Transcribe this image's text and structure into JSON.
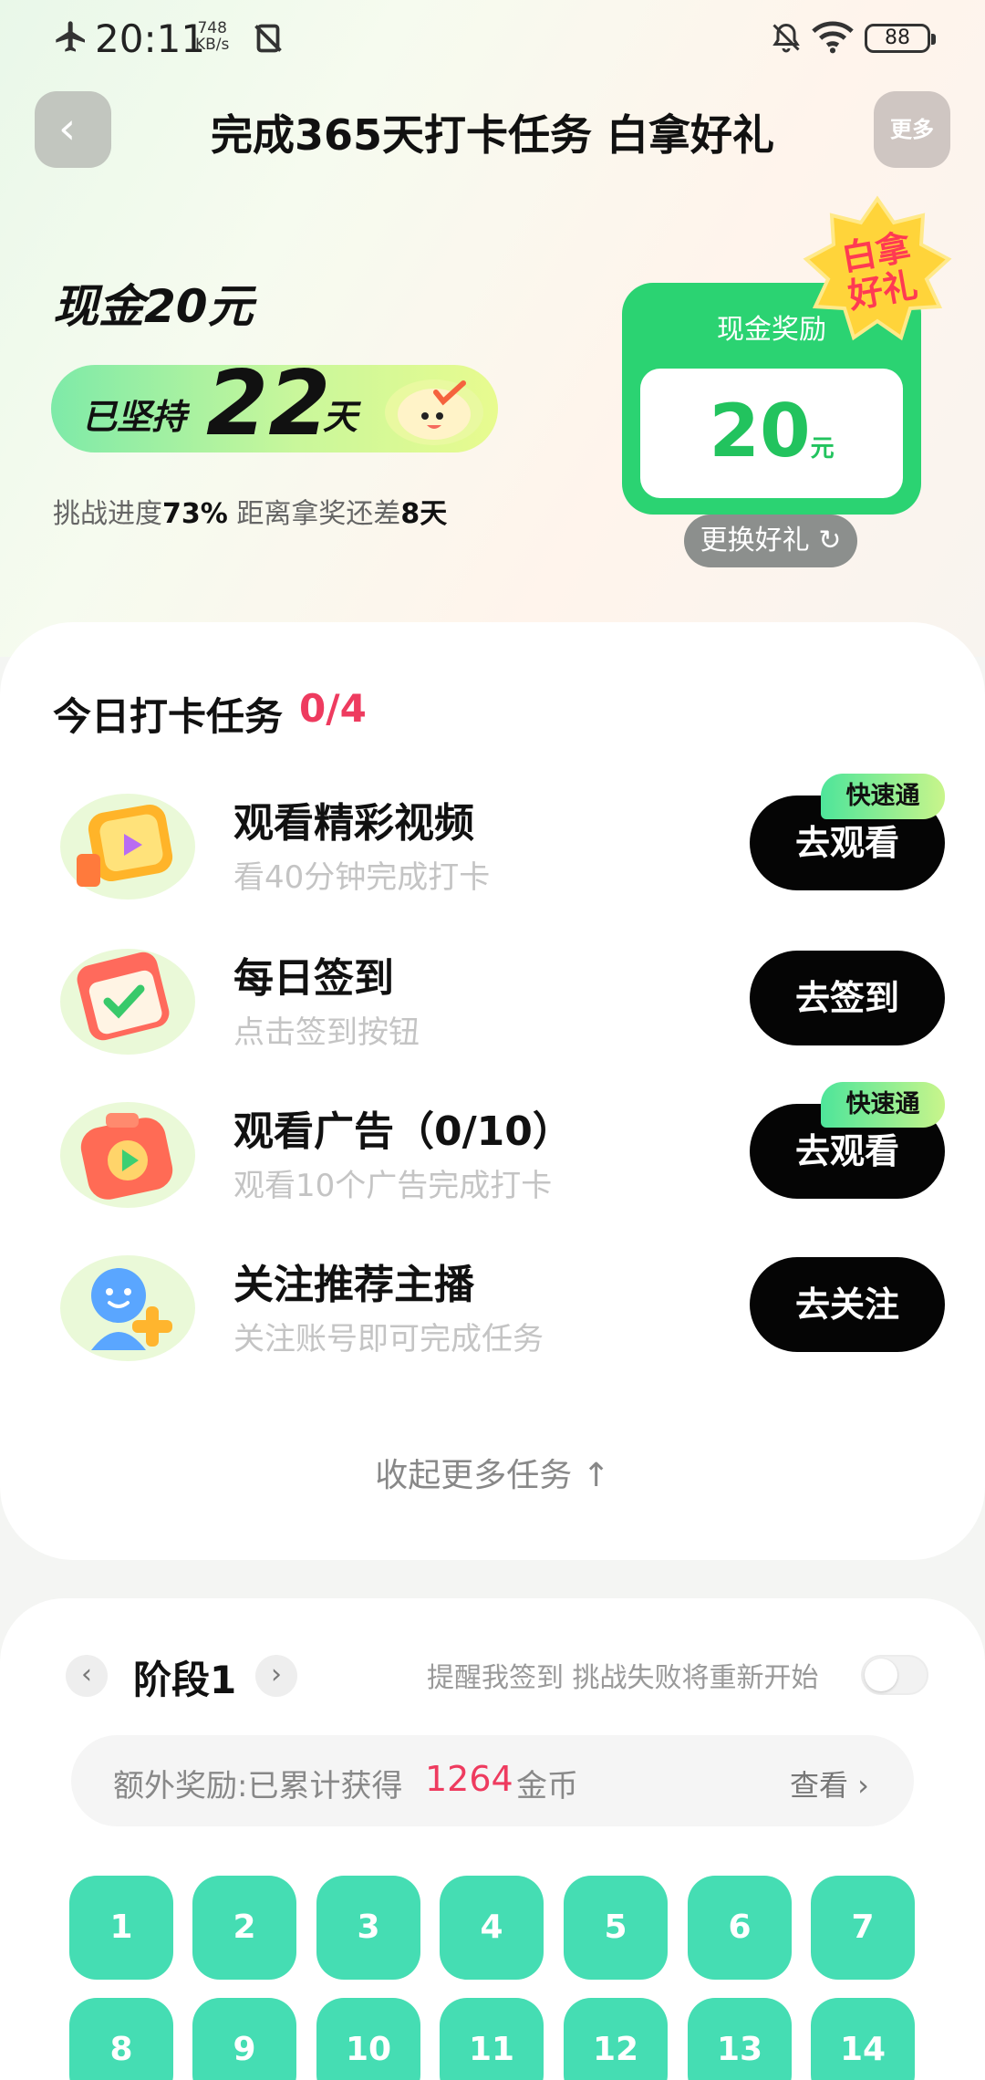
{
  "status_bar": {
    "time": "20:11",
    "net_speed": "748",
    "net_unit": "KB/s",
    "battery": "88"
  },
  "header": {
    "title": "完成365天打卡任务 白拿好礼",
    "more_label": "更多"
  },
  "hero": {
    "cash_title": "现金20元",
    "streak_prefix": "已坚持",
    "streak_days": "22",
    "streak_unit": "天",
    "progress_label": "挑战进度",
    "progress_value": "73%",
    "remaining_label": "距离拿奖还差",
    "remaining_value": "8天",
    "reward": {
      "label": "现金奖励",
      "amount": "20",
      "unit": "元",
      "badge_line1": "白拿",
      "badge_line2": "好礼",
      "change_label": "更换好礼 ↻"
    }
  },
  "tasks": {
    "heading": "今日打卡任务",
    "count": "0/4",
    "fast_tag": "快速通",
    "items": [
      {
        "title": "观看精彩视频",
        "subtitle": "看40分钟完成打卡",
        "button": "去观看",
        "fast": true,
        "icon": "video-icon"
      },
      {
        "title": "每日签到",
        "subtitle": "点击签到按钮",
        "button": "去签到",
        "fast": false,
        "icon": "calendar-check-icon"
      },
      {
        "title": "观看广告（0/10）",
        "subtitle": "观看10个广告完成打卡",
        "button": "去观看",
        "fast": true,
        "icon": "ad-play-icon"
      },
      {
        "title": "关注推荐主播",
        "subtitle": "关注账号即可完成任务",
        "button": "去关注",
        "fast": false,
        "icon": "follow-user-icon"
      }
    ],
    "collapse_label": "收起更多任务 ↑"
  },
  "stage": {
    "name": "阶段1",
    "prev_label": "‹",
    "next_label": "›",
    "remind_label": "提醒我签到 挑战失败将重新开始",
    "bonus_prefix": "额外奖励:已累计获得",
    "bonus_value": "1264",
    "bonus_unit": "金币",
    "view_label": "查看 ›",
    "days": [
      "1",
      "2",
      "3",
      "4",
      "5",
      "6",
      "7",
      "8",
      "9",
      "10",
      "11",
      "12",
      "13",
      "14"
    ]
  },
  "colors": {
    "accent_green": "#2bd372",
    "day_tile": "#45ddb3",
    "highlight_pink": "#ee3b5f",
    "button_black": "#050505"
  }
}
